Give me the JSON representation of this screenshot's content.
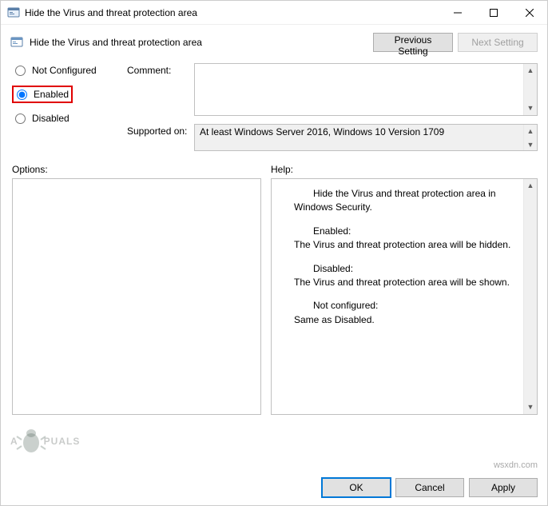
{
  "window": {
    "title": "Hide the Virus and threat protection area"
  },
  "header": {
    "label": "Hide the Virus and threat protection area",
    "previous_btn": "Previous Setting",
    "next_btn": "Next Setting"
  },
  "radios": {
    "not_configured": "Not Configured",
    "enabled": "Enabled",
    "disabled": "Disabled",
    "selected": "enabled"
  },
  "fields": {
    "comment_label": "Comment:",
    "comment_value": "",
    "supported_label": "Supported on:",
    "supported_value": "At least Windows Server 2016, Windows 10 Version 1709"
  },
  "sections": {
    "options_label": "Options:",
    "help_label": "Help:"
  },
  "help": {
    "p1": "Hide the Virus and threat protection area in Windows Security.",
    "p2a": "Enabled:",
    "p2b": "The Virus and threat protection area will be hidden.",
    "p3a": "Disabled:",
    "p3b": "The Virus and threat protection area will be shown.",
    "p4a": "Not configured:",
    "p4b": "Same as Disabled."
  },
  "footer": {
    "ok": "OK",
    "cancel": "Cancel",
    "apply": "Apply"
  },
  "watermark": {
    "text_left": "A",
    "text_right": "PUALS",
    "domain": "wsxdn.com"
  }
}
